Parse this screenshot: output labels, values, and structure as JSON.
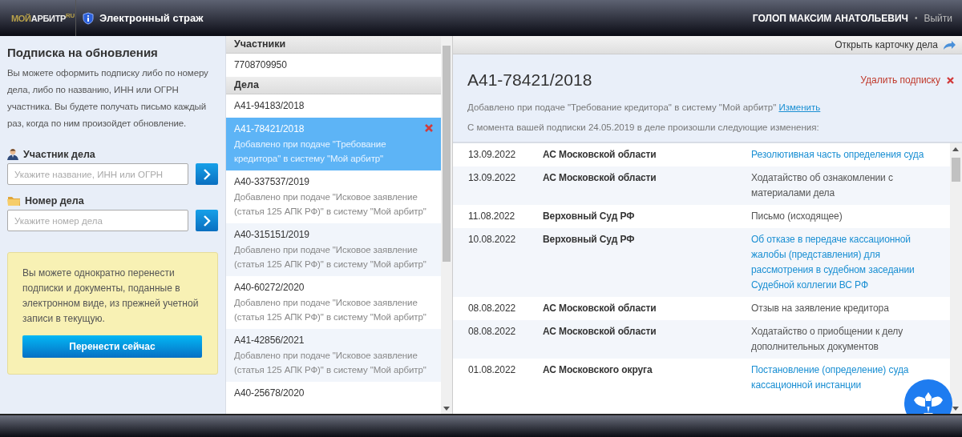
{
  "header": {
    "logo": {
      "first": "МОЙ",
      "second": "АРБИТР",
      "suffix": "RU"
    },
    "service_title": "Электронный страж",
    "user_name": "ГОЛОП МАКСИМ АНАТОЛЬЕВИЧ",
    "separator": "•",
    "logout": "Выйти"
  },
  "subscription": {
    "title": "Подписка на обновления",
    "description": "Вы можете оформить подписку либо по номеру дела, либо по названию, ИНН или ОГРН участника. Вы будете получать письмо каждый раз, когда по ним произойдет обновление.",
    "fields": [
      {
        "kind": "person",
        "label": "Участник дела",
        "placeholder": "Укажите название, ИНН или ОГРН"
      },
      {
        "kind": "folder",
        "label": "Номер дела",
        "placeholder": "Укажите номер дела"
      }
    ],
    "notice": {
      "text": "Вы можете однократно перенести подписки и документы, поданные в электронном виде, из прежней учетной записи в текущую.",
      "button": "Перенести сейчас"
    }
  },
  "list": {
    "sections": [
      {
        "heading": "Участники",
        "items": [
          {
            "number": "7708709950",
            "selected": false
          }
        ]
      },
      {
        "heading": "Дела",
        "items": [
          {
            "number": "А41-94183/2018",
            "selected": false
          },
          {
            "number": "А41-78421/2018",
            "note": "Добавлено при подаче \"Требование кредитора\" в систему \"Мой арбитр\"",
            "selected": true
          },
          {
            "number": "А40-337537/2019",
            "note": "Добавлено при подаче \"Исковое заявление (статья 125 АПК РФ)\" в систему \"Мой арбитр\"",
            "selected": false
          },
          {
            "number": "А40-315151/2019",
            "note": "Добавлено при подаче \"Исковое заявление (статья 125 АПК РФ)\" в систему \"Мой арбитр\"",
            "selected": false
          },
          {
            "number": "А40-60272/2020",
            "note": "Добавлено при подаче \"Исковое заявление (статья 125 АПК РФ)\" в систему \"Мой арбитр\"",
            "selected": false
          },
          {
            "number": "А41-42856/2021",
            "note": "Добавлено при подаче \"Исковое заявление (статья 125 АПК РФ)\" в систему \"Мой арбитр\"",
            "selected": false
          },
          {
            "number": "А40-25678/2020",
            "selected": false
          }
        ]
      }
    ]
  },
  "detail": {
    "open_card": "Открыть карточку дела",
    "case_number": "А41-78421/2018",
    "delete": "Удалить подписку",
    "added_note": "Добавлено при подаче \"Требование кредитора\" в систему \"Мой арбитр\"",
    "change_link": "Изменить",
    "since_text": "С момента вашей подписки 24.05.2019 в деле произошли следующие изменения:",
    "events": [
      {
        "date": "13.09.2022",
        "court": "АС Московской области",
        "document": "Резолютивная часть определения суда",
        "link": true
      },
      {
        "date": "13.09.2022",
        "court": "АС Московской области",
        "document": "Ходатайство об ознакомлении с материалами дела",
        "link": false
      },
      {
        "date": "11.08.2022",
        "court": "Верховный Суд РФ",
        "document": "Письмо (исходящее)",
        "link": false
      },
      {
        "date": "10.08.2022",
        "court": "Верховный Суд РФ",
        "document": "Об отказе в передаче кассационной жалобы (представления) для рассмотрения в судебном заседании Судебной коллегии ВС РФ",
        "link": true
      },
      {
        "date": "08.08.2022",
        "court": "АС Московской области",
        "document": "Отзыв на заявление кредитора",
        "link": false
      },
      {
        "date": "08.08.2022",
        "court": "АС Московской области",
        "document": "Ходатайство о приобщении к делу дополнительных документов",
        "link": false
      },
      {
        "date": "01.08.2022",
        "court": "АС Московского округа",
        "document": "Постановление (определение) суда кассационной инстанции",
        "link": true
      }
    ]
  }
}
